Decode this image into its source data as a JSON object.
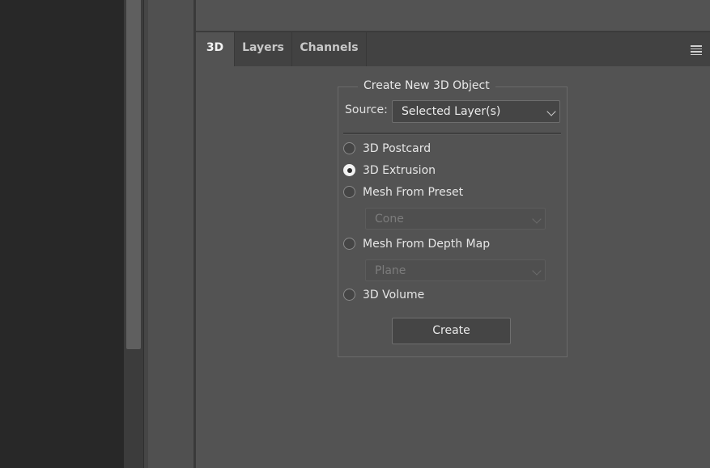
{
  "tabs": [
    {
      "label": "3D",
      "active": true
    },
    {
      "label": "Layers",
      "active": false
    },
    {
      "label": "Channels",
      "active": false
    }
  ],
  "panel_menu_icon": "hamburger-menu-icon",
  "create_3d": {
    "legend": "Create New 3D Object",
    "source_label": "Source:",
    "source_value": "Selected Layer(s)",
    "options": [
      {
        "label": "3D Postcard",
        "selected": false
      },
      {
        "label": "3D Extrusion",
        "selected": true
      },
      {
        "label": "Mesh From Preset",
        "selected": false
      },
      {
        "label": "Mesh From Depth Map",
        "selected": false
      },
      {
        "label": "3D Volume",
        "selected": false
      }
    ],
    "preset_value": "Cone",
    "depth_map_value": "Plane",
    "create_button": "Create"
  },
  "colors": {
    "panel_bg": "#535353",
    "tab_bar_bg": "#424242",
    "left_bg": "#282828"
  }
}
